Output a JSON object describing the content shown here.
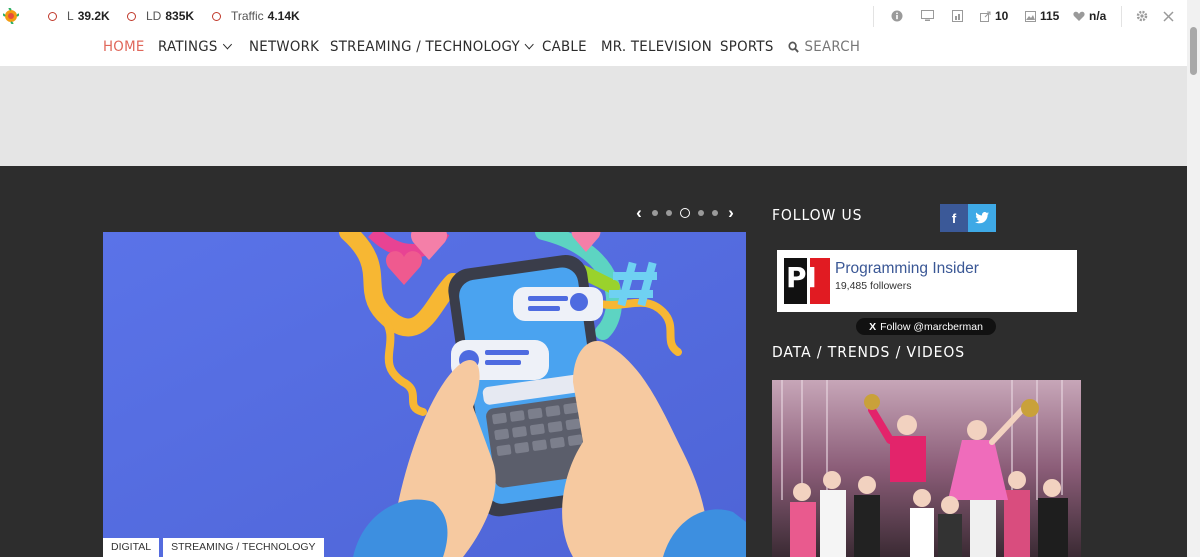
{
  "toolbar": {
    "metrics": [
      {
        "label": "L",
        "value": "39.2K"
      },
      {
        "label": "LD",
        "value": "835K"
      },
      {
        "label": "Traffic",
        "value": "4.14K"
      }
    ],
    "stats": [
      {
        "icon": "external-link-icon",
        "value": "10"
      },
      {
        "icon": "image-icon",
        "value": "115"
      },
      {
        "icon": "heart-icon",
        "value": "n/a"
      }
    ]
  },
  "nav": {
    "home": "HOME",
    "ratings": "RATINGS",
    "network": "NETWORK",
    "streaming": "STREAMING / TECHNOLOGY",
    "cable": "CABLE",
    "mr_tv": "MR. TELEVISION",
    "sports": "SPORTS",
    "search": "SEARCH"
  },
  "slider": {
    "dot_count": 5,
    "active_index": 2
  },
  "hero": {
    "tags": [
      "DIGITAL",
      "STREAMING / TECHNOLOGY"
    ]
  },
  "sidebar": {
    "follow_heading": "FOLLOW US",
    "facebook": "f",
    "card_logo": "PI",
    "card_title": "Programming Insider",
    "card_followers": "19,485 followers",
    "x_follow": "Follow @marcberman",
    "x_logo": "X",
    "data_heading": "DATA / TRENDS / VIDEOS"
  },
  "colors": {
    "accent": "#e0675a",
    "facebook": "#3b5998",
    "twitter": "#3ea9e6",
    "hero_bg": "#5b72e2"
  }
}
